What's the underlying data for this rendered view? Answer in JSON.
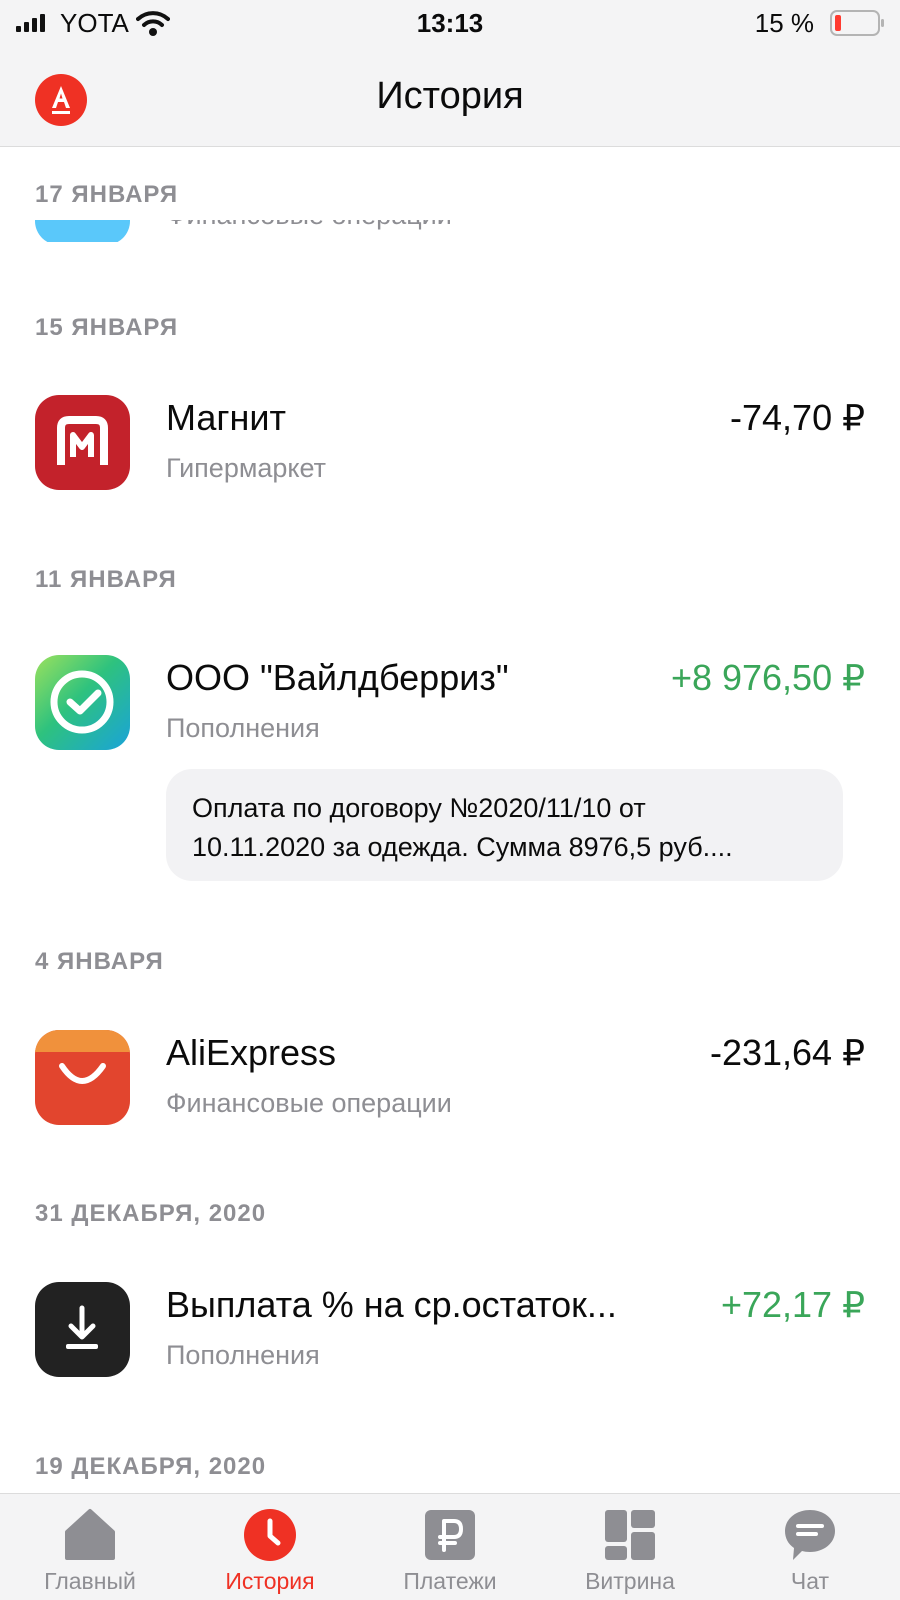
{
  "status_bar": {
    "carrier": "YOTA",
    "time": "13:13",
    "battery": "15 %"
  },
  "header": {
    "logo_icon": "alfa-bank-logo-icon",
    "title": "История"
  },
  "history": {
    "groups": [
      {
        "date": "17 ЯНВАРЯ",
        "partial_subtitle": "Финансовые операции"
      },
      {
        "date": "15 ЯНВАРЯ",
        "transaction": {
          "title": "Магнит",
          "subtitle": "Гипермаркет",
          "amount": "-74,70 ₽",
          "icon": "magnit-logo-icon"
        }
      },
      {
        "date": "11 ЯНВАРЯ",
        "transaction": {
          "title": "ООО \"Вайлдберриз\"",
          "subtitle": "Пополнения",
          "amount": "+8 976,50 ₽",
          "icon": "sbp-checkmark-icon"
        },
        "comment": {
          "line1": "Оплата по договору №2020/11/10 от",
          "line2": "10.11.2020 за одежда. Сумма 8976,5 руб...."
        }
      },
      {
        "date": "4 ЯНВАРЯ",
        "transaction": {
          "title": "AliExpress",
          "subtitle": "Финансовые операции",
          "amount": "-231,64 ₽",
          "icon": "aliexpress-bag-icon"
        }
      },
      {
        "date": "31 ДЕКАБРЯ, 2020",
        "transaction": {
          "title": "Выплата % на ср.остаток...",
          "subtitle": "Пополнения",
          "amount": "+72,17 ₽",
          "icon": "download-arrow-icon"
        }
      },
      {
        "date": "19 ДЕКАБРЯ, 2020"
      }
    ]
  },
  "tab_bar": {
    "tabs": [
      {
        "label": "Главный",
        "icon": "home-icon",
        "active": false
      },
      {
        "label": "История",
        "icon": "clock-icon",
        "active": true
      },
      {
        "label": "Платежи",
        "icon": "ruble-icon",
        "active": false
      },
      {
        "label": "Витрина",
        "icon": "grid-icon",
        "active": false
      },
      {
        "label": "Чат",
        "icon": "chat-bubble-icon",
        "active": false
      }
    ]
  },
  "colors": {
    "brand_red": "#ef3124",
    "positive_amount": "#3aa659",
    "secondary_text": "#8e8e93"
  }
}
